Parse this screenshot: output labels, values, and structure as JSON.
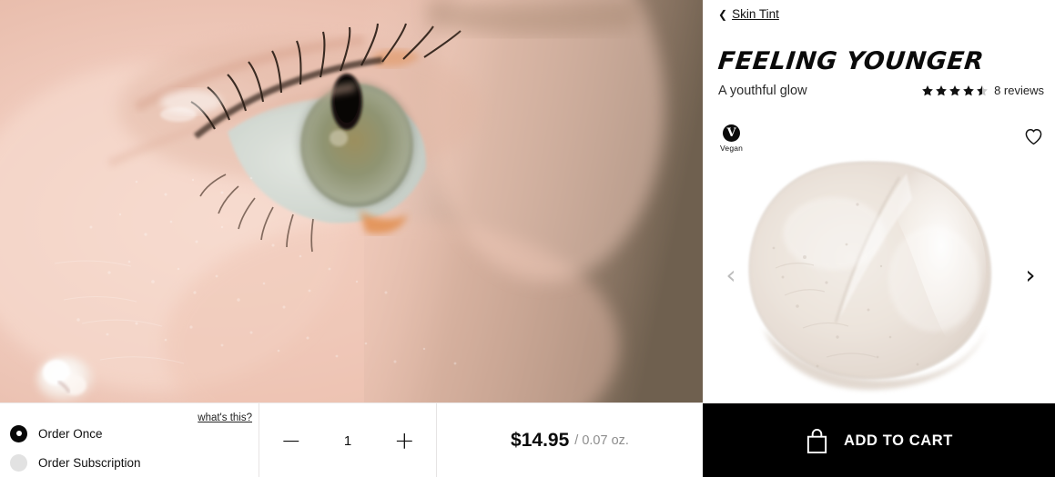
{
  "breadcrumb": {
    "chevron_icon": "chevron-left-icon",
    "label": "Skin Tint"
  },
  "product": {
    "title": "FEELING YOUNGER",
    "subtitle": "A youthful glow",
    "rating": {
      "value": 4.5,
      "max": 5,
      "full_stars": 4,
      "half_stars": 1,
      "reviews_text": "8 reviews",
      "star_color": "#111111"
    },
    "badge": {
      "icon_letter": "V",
      "label": "Vegan",
      "icon_name": "vegan-v-icon",
      "bg_color": "#0a0a0a"
    },
    "wishlist_icon": "heart-outline-icon",
    "carousel": {
      "prev_icon": "chevron-left-icon",
      "prev_glyph": "‹",
      "prev_color": "#bdbdbd",
      "next_icon": "chevron-right-icon",
      "next_glyph": "›",
      "next_color": "#111111",
      "swatch_alt": "cream-swatch-image"
    }
  },
  "hero": {
    "alt": "macro-photo-of-eye-and-skin"
  },
  "purchase": {
    "whats_this_label": "what's this?",
    "options": [
      {
        "label": "Order Once",
        "selected": true
      },
      {
        "label": "Order Subscription",
        "selected": false
      }
    ],
    "quantity": {
      "decrease_glyph": "−",
      "value": "1",
      "increase_glyph": "+"
    },
    "price": {
      "amount": "$14.95",
      "unit": "/ 0.07 oz."
    },
    "cart": {
      "label": "ADD TO CART",
      "icon": "shopping-bag-icon",
      "bg_color": "#000000",
      "text_color": "#ffffff"
    }
  }
}
